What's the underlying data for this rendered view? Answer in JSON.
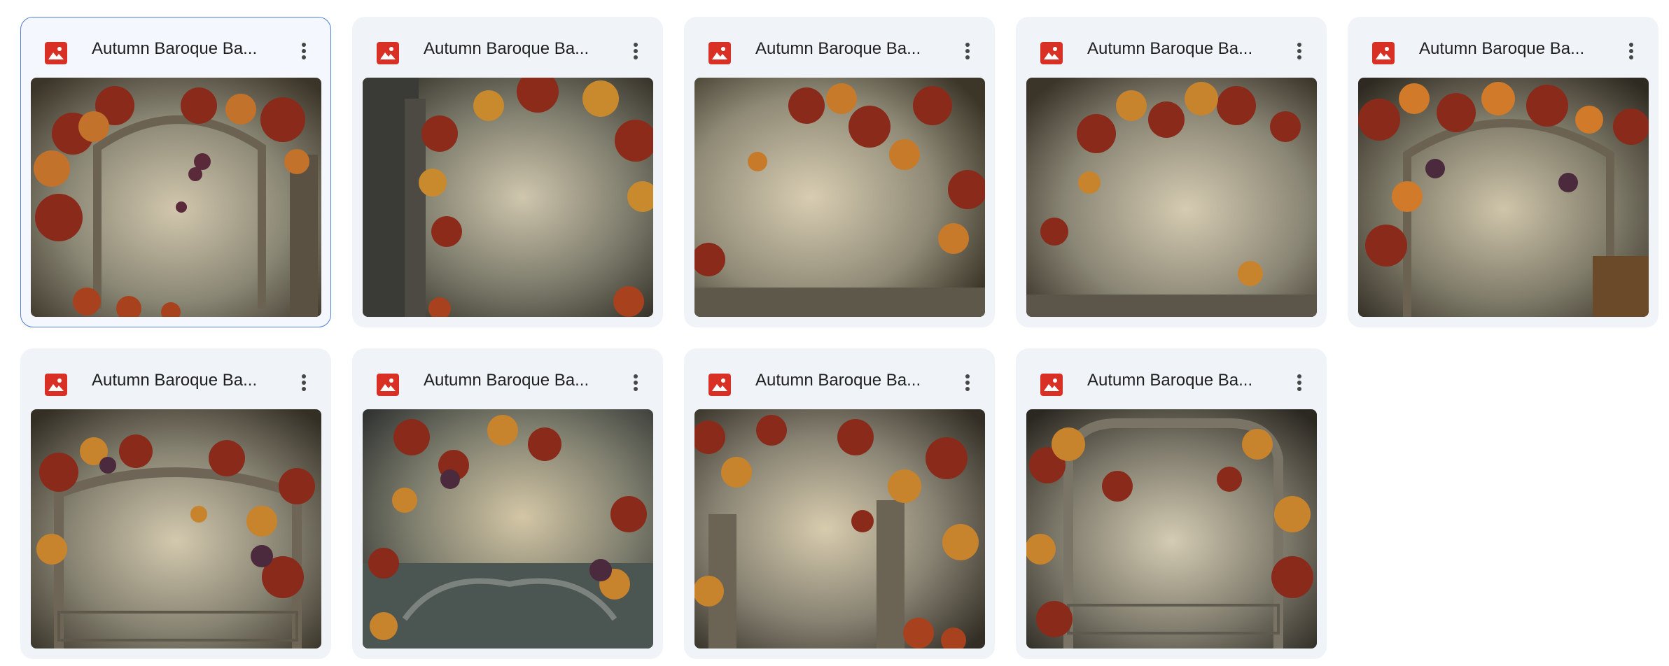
{
  "files": [
    {
      "title": "Autumn Baroque Ba...",
      "selected": true,
      "thumbnail": "autumn-baroque-arch-with-grapevines-right-panel"
    },
    {
      "title": "Autumn Baroque Ba...",
      "selected": false,
      "thumbnail": "autumn-baroque-dark-door-frame-vines"
    },
    {
      "title": "Autumn Baroque Ba...",
      "selected": false,
      "thumbnail": "autumn-baroque-vines-top-and-left"
    },
    {
      "title": "Autumn Baroque Ba...",
      "selected": false,
      "thumbnail": "autumn-baroque-vines-top-left"
    },
    {
      "title": "Autumn Baroque Ba...",
      "selected": false,
      "thumbnail": "autumn-baroque-arch-with-side-table"
    },
    {
      "title": "Autumn Baroque Ba...",
      "selected": false,
      "thumbnail": "autumn-baroque-arch-with-grapes"
    },
    {
      "title": "Autumn Baroque Ba...",
      "selected": false,
      "thumbnail": "autumn-baroque-ornate-panel-vines"
    },
    {
      "title": "Autumn Baroque Ba...",
      "selected": false,
      "thumbnail": "autumn-baroque-pillar-vines"
    },
    {
      "title": "Autumn Baroque Ba...",
      "selected": false,
      "thumbnail": "autumn-baroque-ornate-frame-top"
    }
  ],
  "icons": {
    "file_type": "image-file-icon",
    "more": "more-vert-icon"
  },
  "colors": {
    "image_icon": "#d93025",
    "card_background": "#f0f4f9",
    "selected_border": "#4f7fd8",
    "title_text": "#1f1f1f"
  }
}
